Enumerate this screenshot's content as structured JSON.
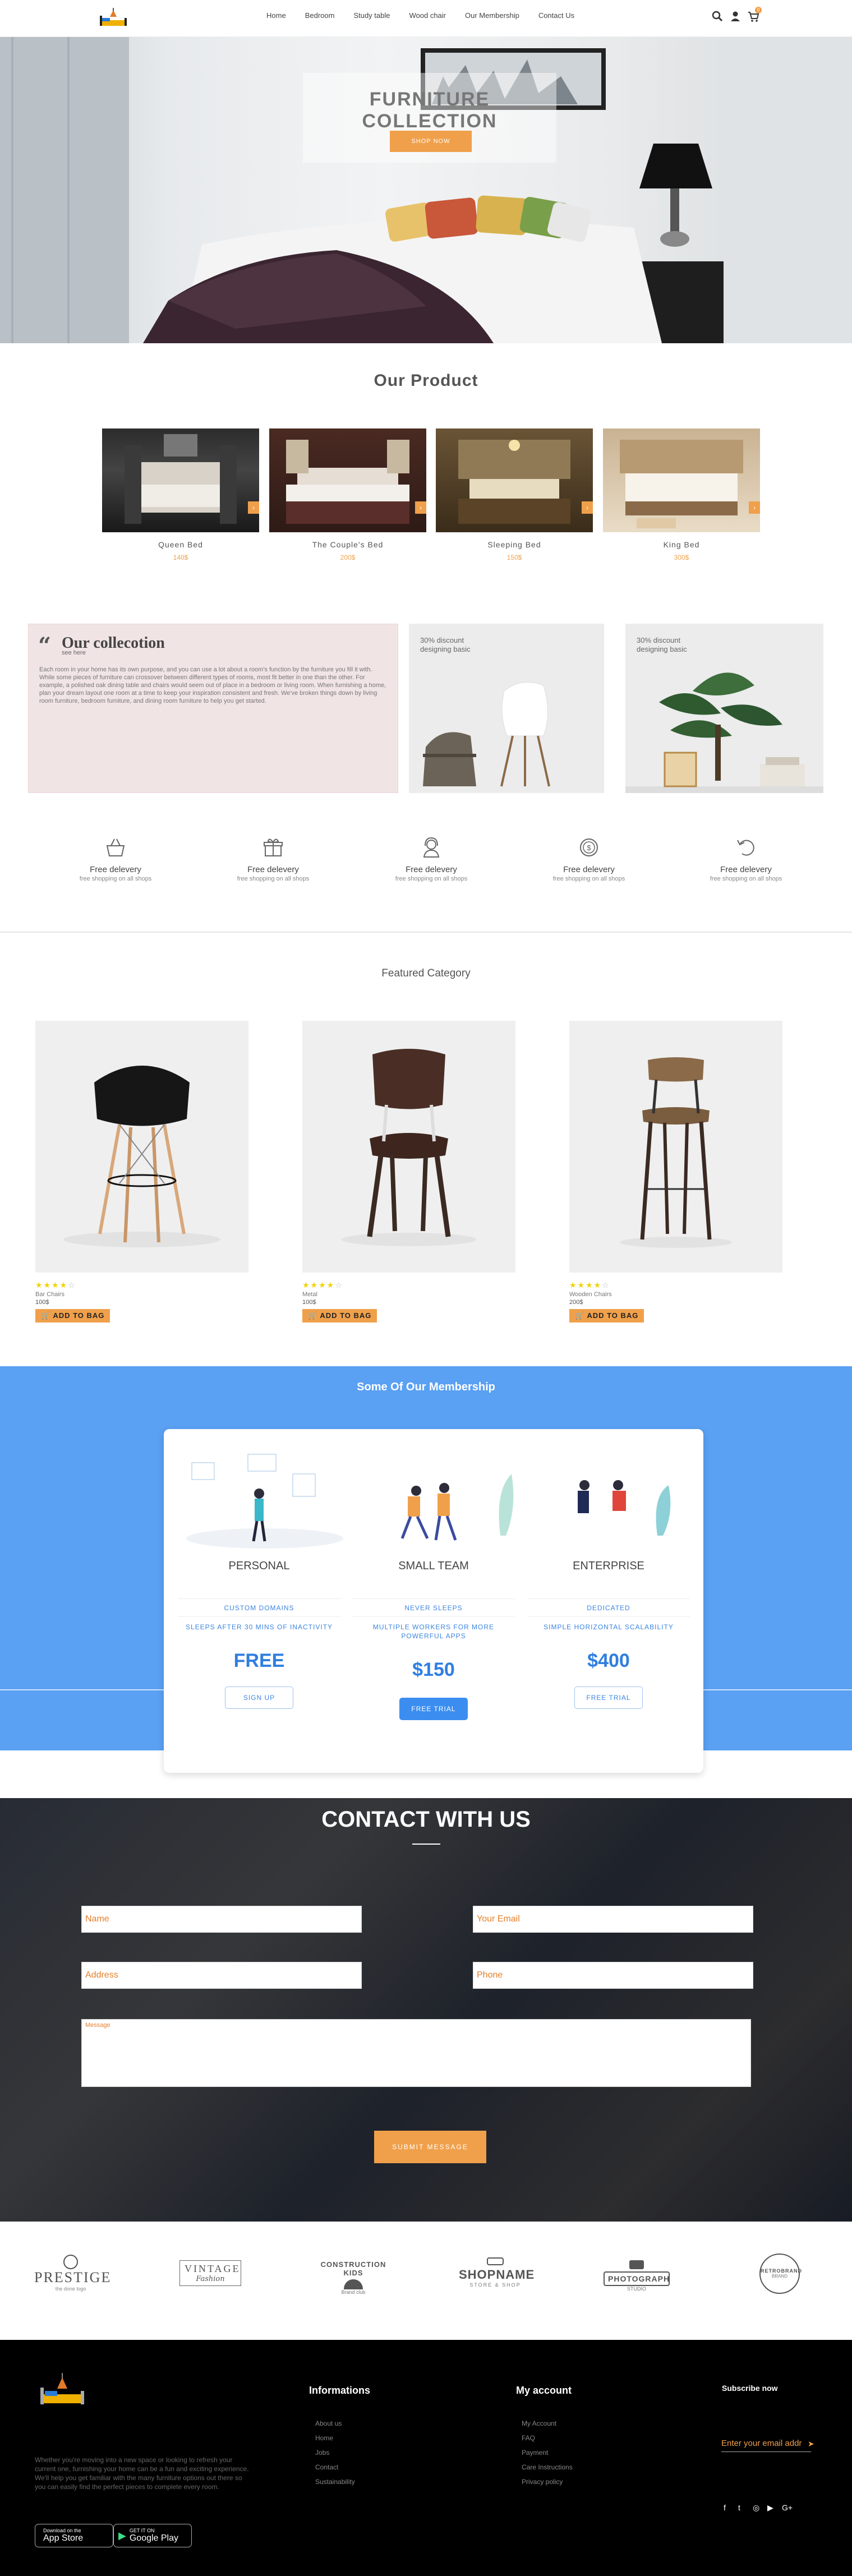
{
  "nav": {
    "links": [
      "Home",
      "Bedroom",
      "Study table",
      "Wood chair",
      "Our Membership",
      "Contact Us"
    ],
    "cart_count": "0"
  },
  "hero": {
    "title": "FURNITURE COLLECTION",
    "button": "SHOP NOW"
  },
  "products": {
    "title": "Our Product",
    "items": [
      {
        "name": "Queen Bed",
        "price": "140$"
      },
      {
        "name": "The Couple's Bed",
        "price": "200$"
      },
      {
        "name": "Sleeping Bed",
        "price": "150$"
      },
      {
        "name": "King Bed",
        "price": "300$"
      }
    ]
  },
  "collection": {
    "title": "Our collecotion",
    "subtitle": "see here",
    "text": "Each room in your home has its own purpose, and you can use a lot about a room's function by the furniture you fill it with. While some pieces of furniture can crossover between different types of rooms, most fit better in one than the other. For example, a polished oak dining table and chairs would seem out of place in a bedroom or living room. When furnishing a home, plan your dream layout one room at a time to keep your inspiration consistent and fresh. We've broken things down by living room furniture, bedroom furniture, and dining room furniture to help you get started.",
    "promos": [
      {
        "line1": "30% discount",
        "line2": "designing basic"
      },
      {
        "line1": "30% discount",
        "line2": "designing basic"
      }
    ]
  },
  "features": [
    {
      "title": "Free delevery",
      "sub": "free shopping on all shops",
      "icon": "basket-icon"
    },
    {
      "title": "Free delevery",
      "sub": "free shopping on all shops",
      "icon": "gift-icon"
    },
    {
      "title": "Free delevery",
      "sub": "free shopping on all shops",
      "icon": "support-icon"
    },
    {
      "title": "Free delevery",
      "sub": "free shopping on all shops",
      "icon": "dollar-badge-icon"
    },
    {
      "title": "Free delevery",
      "sub": "free shopping on all shops",
      "icon": "return-icon"
    }
  ],
  "featured": {
    "title": "Featured Category",
    "items": [
      {
        "name": "Bar Chairs",
        "price": "100$",
        "button": "ADD TO BAG",
        "rating": 4
      },
      {
        "name": "Metal",
        "price": "100$",
        "button": "ADD TO BAG",
        "rating": 4
      },
      {
        "name": "Wooden Chairs",
        "price": "200$",
        "button": "ADD TO BAG",
        "rating": 4
      }
    ]
  },
  "membership": {
    "title": "Some Of Our Membership",
    "plans": [
      {
        "name": "PERSONAL",
        "feature1": "CUSTOM DOMAINS",
        "feature2": "SLEEPS AFTER 30 MINS OF INACTIVITY",
        "price": "FREE",
        "button": "SIGN UP"
      },
      {
        "name": "SMALL TEAM",
        "feature1": "NEVER SLEEPS",
        "feature2": "MULTIPLE WORKERS FOR MORE POWERFUL APPS",
        "price": "$150",
        "button": "FREE TRIAL"
      },
      {
        "name": "ENTERPRISE",
        "feature1": "DEDICATED",
        "feature2": "SIMPLE HORIZONTAL SCALABILITY",
        "price": "$400",
        "button": "FREE TRIAL"
      }
    ]
  },
  "contact": {
    "title": "CONTACT WITH US",
    "name_placeholder": "Name",
    "email_placeholder": "Your Email",
    "address_placeholder": "Address",
    "phone_placeholder": "Phone",
    "message_placeholder": "Message",
    "submit": "SUBMIT MESSAGE"
  },
  "brands": [
    {
      "main": "PRESTIGE",
      "sub": "the done logo"
    },
    {
      "main": "VINTAGE",
      "sub": "Fashion"
    },
    {
      "main": "CONSTRUCTION KIDS",
      "sub": "Brand club"
    },
    {
      "main": "SHOPNAME",
      "sub": "STORE & SHOP"
    },
    {
      "main": "PHOTOGRAPH",
      "sub": "STUDIO"
    },
    {
      "main": "RETROBRAND",
      "sub": "BRAND"
    }
  ],
  "footer": {
    "description": "Whether you're moving into a new space or looking to refresh your current one, furnishing your home can be a fun and exciting experience. We'll help you get familiar with the many furniture options out there so you can easily find the perfect pieces to complete every room.",
    "col1_title": "Informations",
    "col1_links": [
      "About us",
      "Home",
      "Jobs",
      "Contact",
      "Sustainability"
    ],
    "col2_title": "My account",
    "col2_links": [
      "My Account",
      "FAQ",
      "Payment",
      "Care Instructions",
      "Privacy policy"
    ],
    "subscribe_title": "Subscribe now",
    "subscribe_placeholder": "Enter your email addr",
    "app_store_small": "Download on the",
    "app_store_big": "App Store",
    "google_small": "GET IT ON",
    "google_big": "Google Play",
    "social_icons": [
      "facebook-icon",
      "twitter-icon",
      "instagram-icon",
      "youtube-icon",
      "google-plus-icon"
    ]
  }
}
